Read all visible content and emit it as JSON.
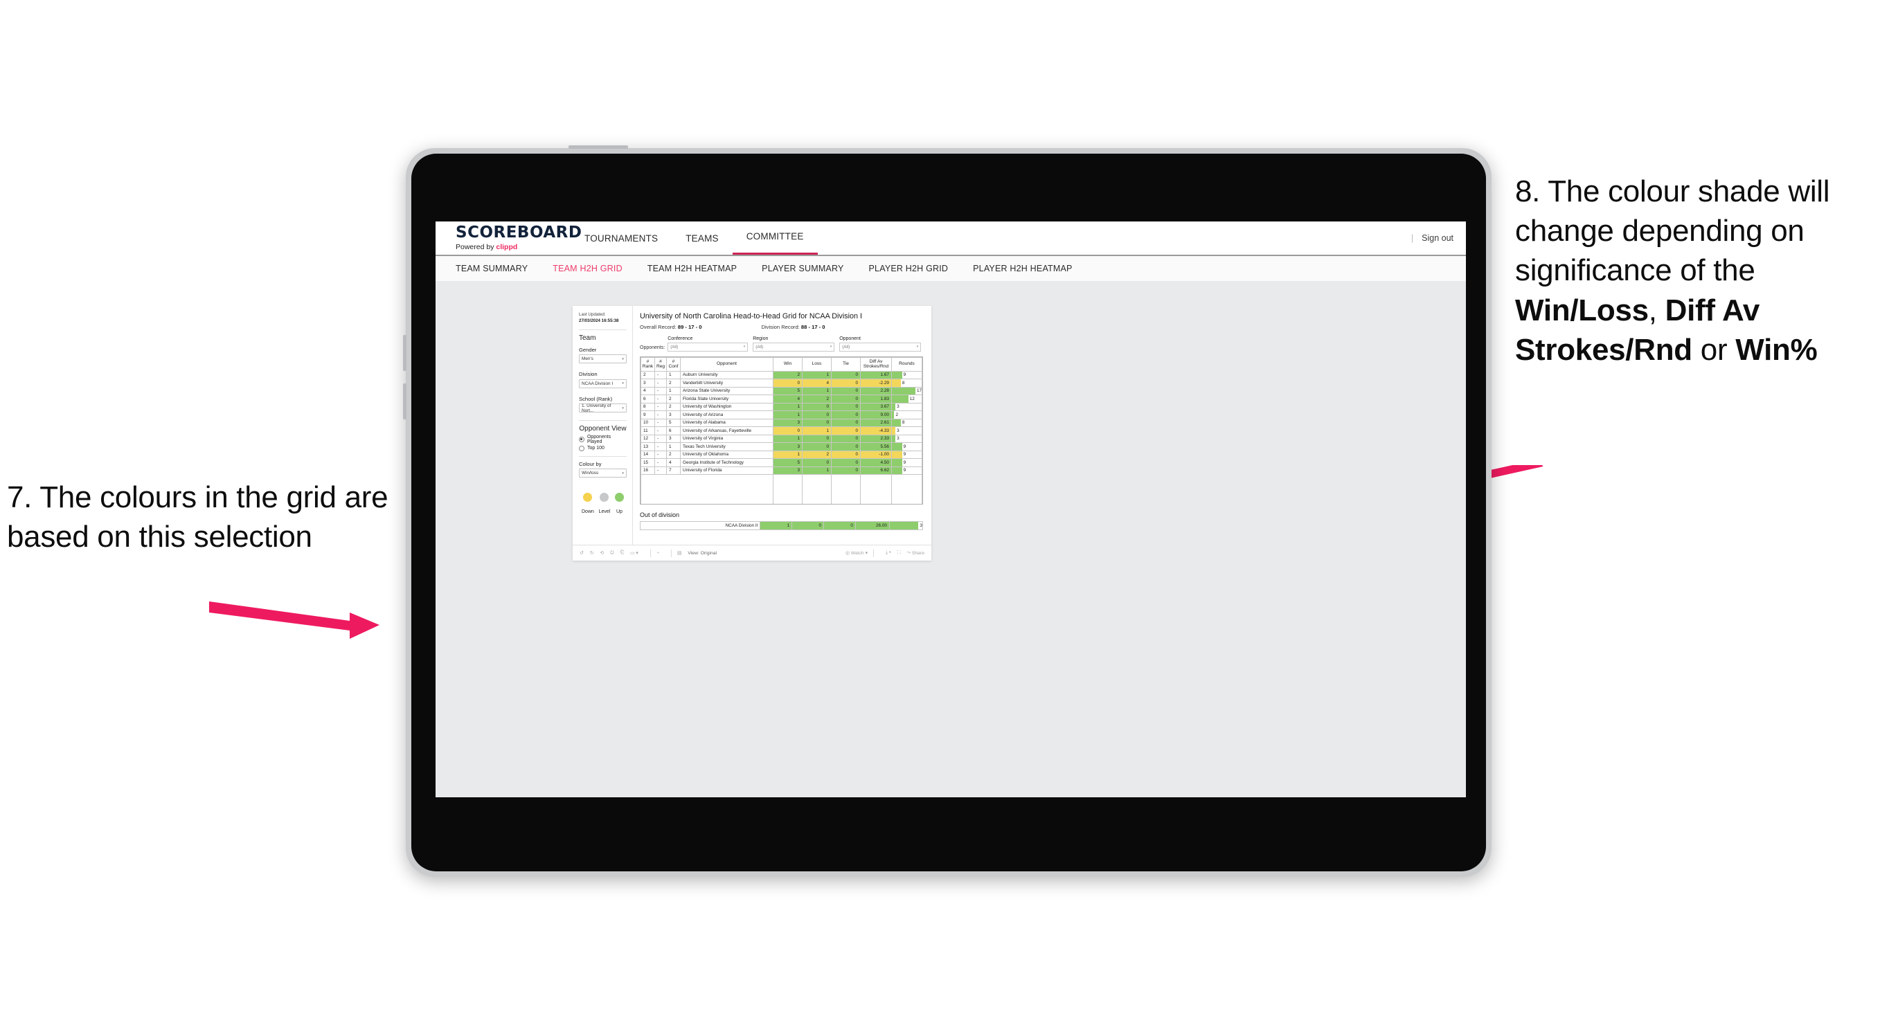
{
  "annotations": {
    "left": {
      "text": "7. The colours in the grid are based on this selection"
    },
    "right": {
      "line1": "8. The colour shade will change depending on significance of the ",
      "bold1": "Win/Loss",
      "mid1": ", ",
      "bold2": "Diff Av Strokes/Rnd",
      "mid2": " or ",
      "bold3": "Win%"
    },
    "accent_color": "#ee1a5f"
  },
  "app": {
    "logo": {
      "title": "SCOREBOARD",
      "powered_prefix": "Powered by ",
      "brand": "clippd"
    },
    "topnav": [
      {
        "label": "TOURNAMENTS",
        "active": false
      },
      {
        "label": "TEAMS",
        "active": false
      },
      {
        "label": "COMMITTEE",
        "active": true
      }
    ],
    "signout": {
      "divider": "|",
      "label": "Sign out"
    },
    "subnav": [
      {
        "label": "TEAM SUMMARY",
        "active": false
      },
      {
        "label": "TEAM H2H GRID",
        "active": true
      },
      {
        "label": "TEAM H2H HEATMAP",
        "active": false
      },
      {
        "label": "PLAYER SUMMARY",
        "active": false
      },
      {
        "label": "PLAYER H2H GRID",
        "active": false
      },
      {
        "label": "PLAYER H2H HEATMAP",
        "active": false
      }
    ]
  },
  "sidebar": {
    "last_updated_label": "Last Updated: ",
    "last_updated_value": "27/03/2024 16:55:38",
    "team_heading": "Team",
    "gender": {
      "label": "Gender",
      "value": "Men's"
    },
    "division": {
      "label": "Division",
      "value": "NCAA Division I"
    },
    "school": {
      "label": "School (Rank)",
      "value": "1. University of Nort..."
    },
    "opponent_view": {
      "heading": "Opponent View",
      "options": [
        {
          "label": "Opponents Played",
          "selected": true
        },
        {
          "label": "Top 100",
          "selected": false
        }
      ]
    },
    "colour_by": {
      "label": "Colour by",
      "value": "Win/loss"
    },
    "legend": [
      {
        "label": "Down",
        "color": "#f5d14e"
      },
      {
        "label": "Level",
        "color": "#c6c8ca"
      },
      {
        "label": "Up",
        "color": "#8ecd6c"
      }
    ]
  },
  "main": {
    "title": "University of North Carolina Head-to-Head Grid for NCAA Division I",
    "overall_record_label": "Overall Record: ",
    "overall_record_value": "89 - 17 - 0",
    "division_record_label": "Division Record: ",
    "division_record_value": "88 - 17 - 0",
    "opponents_label": "Opponents:",
    "filters": [
      {
        "label": "Conference",
        "value": "(All)"
      },
      {
        "label": "Region",
        "value": "(All)"
      },
      {
        "label": "Opponent",
        "value": "(All)"
      }
    ],
    "columns": [
      "# Rank",
      "# Reg",
      "# Conf",
      "Opponent",
      "Win",
      "Loss",
      "Tie",
      "Diff Av Strokes/Rnd",
      "Rounds"
    ],
    "column_lines": [
      [
        "#",
        "Rank"
      ],
      [
        "#",
        "Reg"
      ],
      [
        "#",
        "Conf"
      ],
      [
        "Opponent",
        ""
      ],
      [
        "Win",
        ""
      ],
      [
        "Loss",
        ""
      ],
      [
        "Tie",
        ""
      ],
      [
        "Diff Av",
        "Strokes/Rnd"
      ],
      [
        "Rounds",
        ""
      ]
    ],
    "rows": [
      {
        "rank": "2",
        "reg": "-",
        "conf": "1",
        "opponent": "Auburn University",
        "win": "2",
        "loss": "1",
        "tie": "0",
        "diff": "1.67",
        "rounds": "9",
        "shade": "g",
        "bar_pct": 34
      },
      {
        "rank": "3",
        "reg": "-",
        "conf": "2",
        "opponent": "Vanderbilt University",
        "win": "0",
        "loss": "4",
        "tie": "0",
        "diff": "-2.29",
        "rounds": "8",
        "shade": "y",
        "bar_pct": 30
      },
      {
        "rank": "4",
        "reg": "-",
        "conf": "1",
        "opponent": "Arizona State University",
        "win": "5",
        "loss": "1",
        "tie": "0",
        "diff": "2.28",
        "rounds": "17",
        "shade": "g",
        "bar_pct": 79
      },
      {
        "rank": "6",
        "reg": "-",
        "conf": "2",
        "opponent": "Florida State University",
        "win": "4",
        "loss": "2",
        "tie": "0",
        "diff": "1.83",
        "rounds": "12",
        "shade": "g",
        "bar_pct": 55
      },
      {
        "rank": "8",
        "reg": "-",
        "conf": "2",
        "opponent": "University of Washington",
        "win": "1",
        "loss": "0",
        "tie": "0",
        "diff": "3.67",
        "rounds": "3",
        "shade": "g",
        "bar_pct": 12
      },
      {
        "rank": "9",
        "reg": "-",
        "conf": "3",
        "opponent": "University of Arizona",
        "win": "1",
        "loss": "0",
        "tie": "0",
        "diff": "9.00",
        "rounds": "2",
        "shade": "g",
        "bar_pct": 8
      },
      {
        "rank": "10",
        "reg": "-",
        "conf": "5",
        "opponent": "University of Alabama",
        "win": "3",
        "loss": "0",
        "tie": "0",
        "diff": "2.61",
        "rounds": "8",
        "shade": "g",
        "bar_pct": 30
      },
      {
        "rank": "11",
        "reg": "-",
        "conf": "6",
        "opponent": "University of Arkansas, Fayetteville",
        "win": "0",
        "loss": "1",
        "tie": "0",
        "diff": "-4.33",
        "rounds": "3",
        "shade": "y",
        "bar_pct": 12
      },
      {
        "rank": "12",
        "reg": "-",
        "conf": "3",
        "opponent": "University of Virginia",
        "win": "1",
        "loss": "0",
        "tie": "0",
        "diff": "2.33",
        "rounds": "3",
        "shade": "g",
        "bar_pct": 12
      },
      {
        "rank": "13",
        "reg": "-",
        "conf": "1",
        "opponent": "Texas Tech University",
        "win": "3",
        "loss": "0",
        "tie": "0",
        "diff": "5.56",
        "rounds": "9",
        "shade": "g",
        "bar_pct": 34
      },
      {
        "rank": "14",
        "reg": "-",
        "conf": "2",
        "opponent": "University of Oklahoma",
        "win": "1",
        "loss": "2",
        "tie": "0",
        "diff": "-1.00",
        "rounds": "9",
        "shade": "y",
        "bar_pct": 34
      },
      {
        "rank": "15",
        "reg": "-",
        "conf": "4",
        "opponent": "Georgia Institute of Technology",
        "win": "5",
        "loss": "0",
        "tie": "0",
        "diff": "4.50",
        "rounds": "9",
        "shade": "g",
        "bar_pct": 34
      },
      {
        "rank": "16",
        "reg": "-",
        "conf": "7",
        "opponent": "University of Florida",
        "win": "3",
        "loss": "1",
        "tie": "0",
        "diff": "6.62",
        "rounds": "9",
        "shade": "g",
        "bar_pct": 34
      }
    ],
    "out_of_division": {
      "heading": "Out of division",
      "row": {
        "opponent": "NCAA Division II",
        "win": "1",
        "loss": "0",
        "tie": "0",
        "diff": "26.00",
        "rounds": "3",
        "shade": "g",
        "bar_pct": 88
      }
    },
    "colors": {
      "up": "#8ecd6c",
      "down": "#f2d75b",
      "level": "#c6c8ca"
    }
  },
  "bottombar": {
    "view_label": "View: Original",
    "watch_label": "Watch",
    "share_label": "Share"
  },
  "chart_data": {
    "type": "table",
    "title": "University of North Carolina Head-to-Head Grid for NCAA Division I",
    "columns": [
      "# Rank",
      "# Reg",
      "# Conf",
      "Opponent",
      "Win",
      "Loss",
      "Tie",
      "Diff Av Strokes/Rnd",
      "Rounds"
    ],
    "rows": [
      [
        "2",
        "-",
        "1",
        "Auburn University",
        2,
        1,
        0,
        1.67,
        9
      ],
      [
        "3",
        "-",
        "2",
        "Vanderbilt University",
        0,
        4,
        0,
        -2.29,
        8
      ],
      [
        "4",
        "-",
        "1",
        "Arizona State University",
        5,
        1,
        0,
        2.28,
        17
      ],
      [
        "6",
        "-",
        "2",
        "Florida State University",
        4,
        2,
        0,
        1.83,
        12
      ],
      [
        "8",
        "-",
        "2",
        "University of Washington",
        1,
        0,
        0,
        3.67,
        3
      ],
      [
        "9",
        "-",
        "3",
        "University of Arizona",
        1,
        0,
        0,
        9.0,
        2
      ],
      [
        "10",
        "-",
        "5",
        "University of Alabama",
        3,
        0,
        0,
        2.61,
        8
      ],
      [
        "11",
        "-",
        "6",
        "University of Arkansas, Fayetteville",
        0,
        1,
        0,
        -4.33,
        3
      ],
      [
        "12",
        "-",
        "3",
        "University of Virginia",
        1,
        0,
        0,
        2.33,
        3
      ],
      [
        "13",
        "-",
        "1",
        "Texas Tech University",
        3,
        0,
        0,
        5.56,
        9
      ],
      [
        "14",
        "-",
        "2",
        "University of Oklahoma",
        1,
        2,
        0,
        -1.0,
        9
      ],
      [
        "15",
        "-",
        "4",
        "Georgia Institute of Technology",
        5,
        0,
        0,
        4.5,
        9
      ],
      [
        "16",
        "-",
        "7",
        "University of Florida",
        3,
        1,
        0,
        6.62,
        9
      ]
    ],
    "out_of_division": [
      [
        "NCAA Division II",
        1,
        0,
        0,
        26.0,
        3
      ]
    ],
    "colour_encoding": "Win/loss",
    "legend": [
      {
        "label": "Down",
        "color": "#f5d14e"
      },
      {
        "label": "Level",
        "color": "#c6c8ca"
      },
      {
        "label": "Up",
        "color": "#8ecd6c"
      }
    ]
  }
}
